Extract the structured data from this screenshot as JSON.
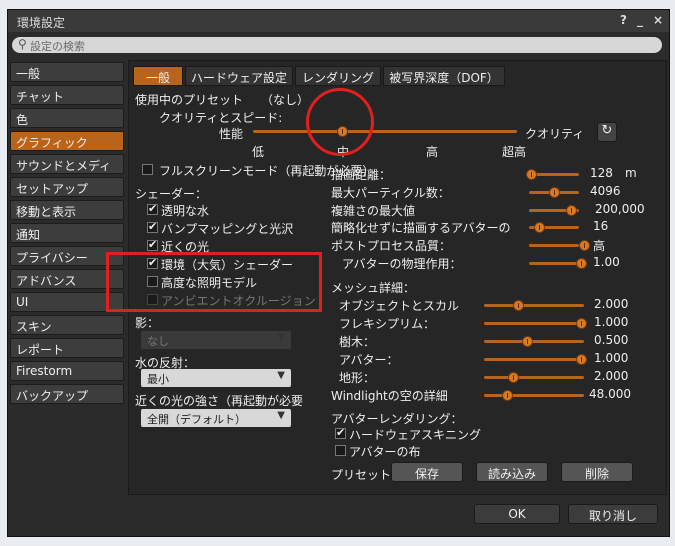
{
  "window": {
    "title": "環境設定",
    "help_icon": "?",
    "min_icon": "_",
    "close_icon": "×"
  },
  "search": {
    "placeholder": "設定の検索"
  },
  "sidebar": {
    "items": [
      {
        "label": "一般"
      },
      {
        "label": "チャット"
      },
      {
        "label": "色"
      },
      {
        "label": "グラフィック",
        "selected": true
      },
      {
        "label": "サウンドとメディア"
      },
      {
        "label": "セットアップ"
      },
      {
        "label": "移動と表示"
      },
      {
        "label": "通知"
      },
      {
        "label": "プライバシー"
      },
      {
        "label": "アドバンス"
      },
      {
        "label": "UI"
      },
      {
        "label": "スキン"
      },
      {
        "label": "レポート"
      },
      {
        "label": "Firestorm"
      },
      {
        "label": "バックアップ"
      }
    ]
  },
  "tabs": [
    {
      "label": "一般",
      "selected": true
    },
    {
      "label": "ハードウェア設定"
    },
    {
      "label": "レンダリング"
    },
    {
      "label": "被写界深度（DOF）"
    }
  ],
  "preset": {
    "label": "使用中のプリセット",
    "value": "（なし）"
  },
  "quality": {
    "label": "クオリティとスピード:",
    "left_label": "性能",
    "right_label": "クオリティ",
    "ticks": [
      "低",
      "中",
      "高",
      "超高"
    ],
    "level": "中"
  },
  "fullscreen": {
    "label": "フルスクリーンモード（再起動が必要）",
    "checked": false
  },
  "shaders": {
    "label": "シェーダー：",
    "items": [
      {
        "label": "透明な水",
        "checked": true
      },
      {
        "label": "バンプマッピングと光沢",
        "checked": true
      },
      {
        "label": "近くの光",
        "checked": true
      },
      {
        "label": "環境（大気）シェーダー",
        "checked": true
      },
      {
        "label": "高度な照明モデル",
        "checked": false
      },
      {
        "label": "アンビエントオクルージョン",
        "checked": false,
        "disabled": true
      }
    ]
  },
  "shadows": {
    "label": "影：",
    "value": "なし"
  },
  "water": {
    "label": "水の反射：",
    "value": "最小"
  },
  "nearby_lights": {
    "label": "近くの光の強さ（再起動が必要",
    "value": "全開（デフォルト）"
  },
  "right_sliders": [
    {
      "label": "描画距離：",
      "value": "128",
      "unit": "m",
      "level": 0.05
    },
    {
      "label": "最大パーティクル数：",
      "value": "4096",
      "level": 0.5
    },
    {
      "label": "複雑さの最大値",
      "value": "200,000",
      "level": 0.75
    },
    {
      "label": "簡略化せずに描画するアバターの",
      "value": "16",
      "level": 0.25
    },
    {
      "label": "ポストプロセス品質：",
      "value": "高",
      "level": 1.0
    },
    {
      "label": "アバターの物理作用：",
      "value": "1.00",
      "level": 1.0
    }
  ],
  "mesh": {
    "label": "メッシュ詳細：",
    "sliders": [
      {
        "label": "オブジェクトとスカル",
        "value": "2.000",
        "level": 0.33
      },
      {
        "label": "フレキシプリム：",
        "value": "1.000",
        "level": 1.0
      },
      {
        "label": "樹木：",
        "value": "0.500",
        "level": 0.4
      },
      {
        "label": "アバター：",
        "value": "1.000",
        "level": 1.0
      },
      {
        "label": "地形：",
        "value": "2.000",
        "level": 0.28
      },
      {
        "label": "Windlightの空の詳細",
        "value": "48.000",
        "level": 0.22
      }
    ]
  },
  "avatar_rendering": {
    "label": "アバターレンダリング：",
    "items": [
      {
        "label": "ハードウェアスキニング",
        "checked": true
      },
      {
        "label": "アバターの布",
        "checked": false
      }
    ]
  },
  "presets": {
    "label": "プリセット",
    "save": "保存",
    "load": "読み込み",
    "delete": "削除"
  },
  "footer": {
    "ok": "OK",
    "cancel": "取り消し"
  },
  "colors": {
    "accent": "#b8641a",
    "highlight": "#e0201e"
  }
}
